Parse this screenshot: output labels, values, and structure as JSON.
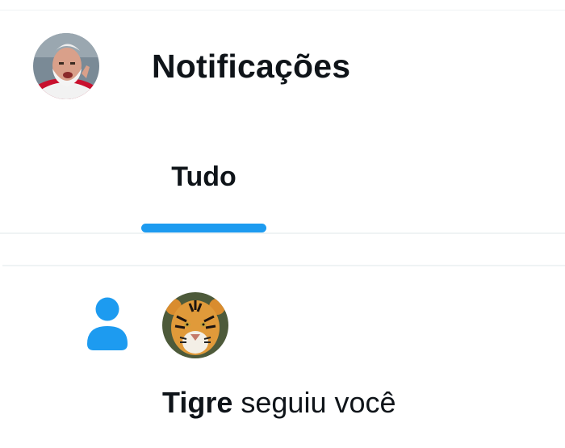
{
  "header": {
    "title": "Notificações"
  },
  "tabs": [
    {
      "label": "Tudo",
      "selected": true
    }
  ],
  "notifications": [
    {
      "type": "follow",
      "icon": "person-icon",
      "follower_name": "Tigre",
      "action_text": " seguiu você"
    }
  ],
  "colors": {
    "accent": "#1d9bf0",
    "text": "#0f1419",
    "divider": "#eff3f4"
  }
}
